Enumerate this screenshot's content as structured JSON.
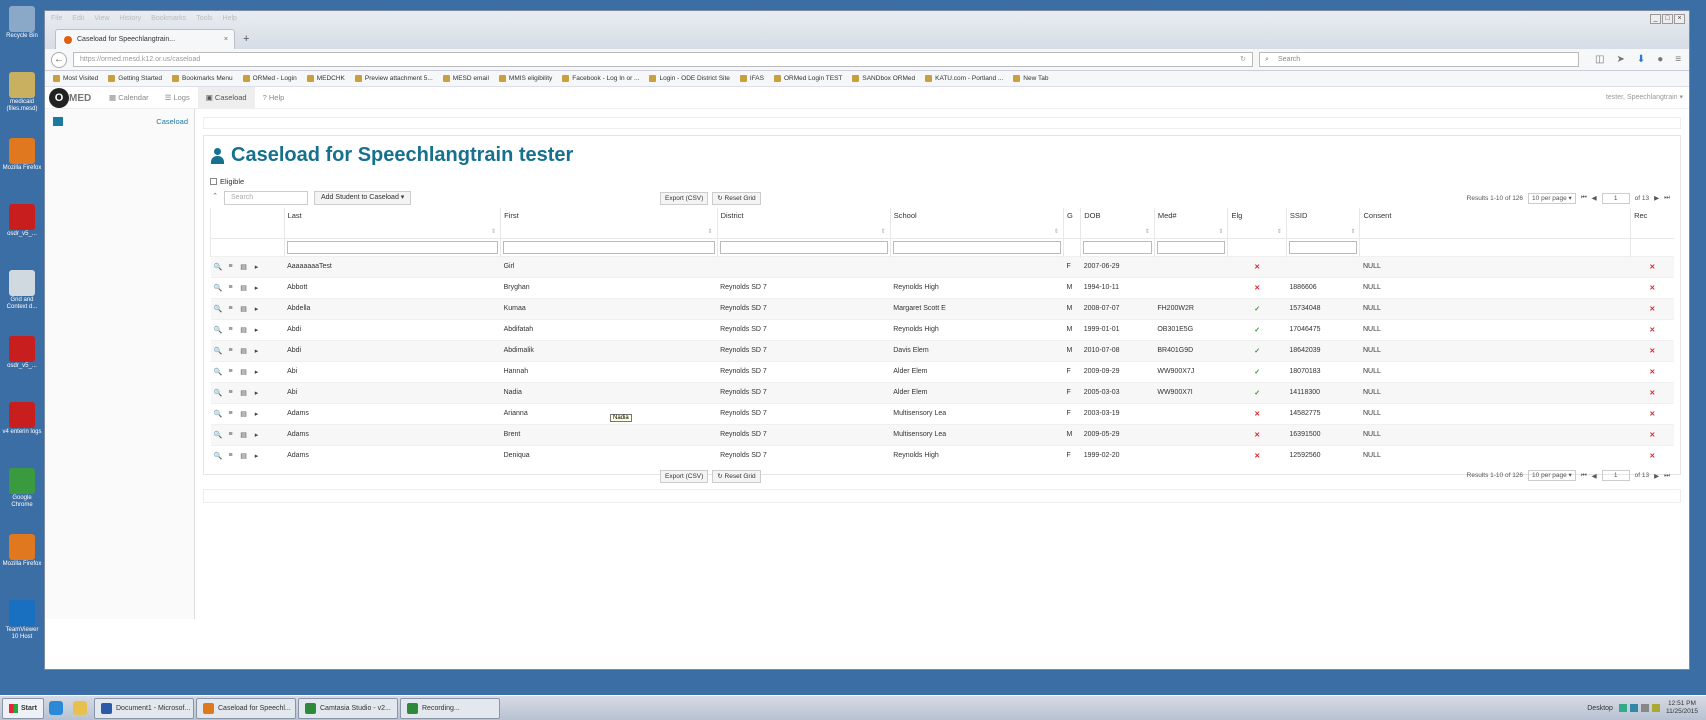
{
  "desktop": {
    "icons": [
      {
        "label": "Recycle Bin",
        "color": "#8aa8c8"
      },
      {
        "label": "medicaid (files.mesd)",
        "color": "#c8b060"
      },
      {
        "label": "Mozilla Firefox",
        "color": "#e07820"
      },
      {
        "label": "osdr_v5_...",
        "color": "#c81e1e"
      },
      {
        "label": "Grid and Context d...",
        "color": "#d0d8e0"
      },
      {
        "label": "osdr_v5_...",
        "color": "#c81e1e"
      },
      {
        "label": "v4 enterin logs",
        "color": "#c81e1e"
      },
      {
        "label": "Google Chrome",
        "color": "#3a9a40"
      },
      {
        "label": "Mozilla Firefox",
        "color": "#e07820"
      },
      {
        "label": "TeamViewer 10 Host",
        "color": "#1a70c0"
      }
    ]
  },
  "browser": {
    "menu": [
      "File",
      "Edit",
      "View",
      "History",
      "Bookmarks",
      "Tools",
      "Help"
    ],
    "tab_title": "Caseload for Speechlangtrain...",
    "tab_close": "×",
    "new_tab": "+",
    "url": "https://ormed.mesd.k12.or.us/caseload",
    "search_placeholder": "Search",
    "bookmarks": [
      "Most Visited",
      "Getting Started",
      "Bookmarks Menu",
      "ORMed - Login",
      "MEDCHK",
      "Preview attachment 5...",
      "MESD email",
      "MMIS eligibility",
      "Facebook - Log In or ...",
      "Login - ODE District Site",
      "IFAS",
      "ORMed Login TEST",
      "SANDbox ORMed",
      "KATU.com - Portland ...",
      "New Tab"
    ]
  },
  "app": {
    "logo_o": "O",
    "logo_rest": "MED",
    "nav": [
      {
        "label": "Calendar",
        "icon": "▦"
      },
      {
        "label": "Logs",
        "icon": "☰"
      },
      {
        "label": "Caseload",
        "icon": "▣"
      },
      {
        "label": "Help",
        "icon": "?"
      }
    ],
    "user": "tester, Speechlangtrain ▾",
    "sidebar_link": "Caseload",
    "title": "Caseload for Speechlangtrain tester",
    "eligible_label": "Eligible",
    "search_placeholder": "Search",
    "add_student": "Add Student to Caseload ▾",
    "export": "Export (CSV)",
    "reset": "↻ Reset Grid",
    "results": "Results 1-10 of 126",
    "per_page": "10 per page ▾",
    "page": "1",
    "of_pages": "of 13",
    "columns": [
      "Last",
      "First",
      "District",
      "School",
      "G",
      "DOB",
      "Med#",
      "Elg",
      "SSID",
      "Consent",
      "Rec"
    ],
    "rows": [
      {
        "last": "AaaaaaaaTest",
        "first": "Girl",
        "district": "",
        "school": "",
        "g": "F",
        "dob": "2007-06-29",
        "med": "",
        "elg": "x",
        "ssid": "",
        "consent": "NULL",
        "rec": "x"
      },
      {
        "last": "Abbott",
        "first": "Bryghan",
        "district": "Reynolds SD 7",
        "school": "Reynolds High",
        "g": "M",
        "dob": "1994-10-11",
        "med": "",
        "elg": "x",
        "ssid": "1886606",
        "consent": "NULL",
        "rec": "x"
      },
      {
        "last": "Abdella",
        "first": "Kumaa",
        "district": "Reynolds SD 7",
        "school": "Margaret Scott E",
        "g": "M",
        "dob": "2008-07-07",
        "med": "FH200W2R",
        "elg": "v",
        "ssid": "15734048",
        "consent": "NULL",
        "rec": "x"
      },
      {
        "last": "Abdi",
        "first": "Abdifatah",
        "district": "Reynolds SD 7",
        "school": "Reynolds High",
        "g": "M",
        "dob": "1999-01-01",
        "med": "OB301E5G",
        "elg": "v",
        "ssid": "17046475",
        "consent": "NULL",
        "rec": "x"
      },
      {
        "last": "Abdi",
        "first": "Abdimalik",
        "district": "Reynolds SD 7",
        "school": "Davis Elem",
        "g": "M",
        "dob": "2010-07-08",
        "med": "BR401G9D",
        "elg": "v",
        "ssid": "18642039",
        "consent": "NULL",
        "rec": "x"
      },
      {
        "last": "Abi",
        "first": "Hannah",
        "district": "Reynolds SD 7",
        "school": "Alder Elem",
        "g": "F",
        "dob": "2009-09-29",
        "med": "WW900X7J",
        "elg": "v",
        "ssid": "18070183",
        "consent": "NULL",
        "rec": "x"
      },
      {
        "last": "Abi",
        "first": "Nadia",
        "district": "Reynolds SD 7",
        "school": "Alder Elem",
        "g": "F",
        "dob": "2005-03-03",
        "med": "WW900X7I",
        "elg": "v",
        "ssid": "14118300",
        "consent": "NULL",
        "rec": "x"
      },
      {
        "last": "Adams",
        "first": "Arianna",
        "district": "Reynolds SD 7",
        "school": "Multisensory Lea",
        "g": "F",
        "dob": "2003-03-19",
        "med": "",
        "elg": "x",
        "ssid": "14582775",
        "consent": "NULL",
        "rec": "x"
      },
      {
        "last": "Adams",
        "first": "Brent",
        "district": "Reynolds SD 7",
        "school": "Multisensory Lea",
        "g": "M",
        "dob": "2009-05-29",
        "med": "",
        "elg": "x",
        "ssid": "16391500",
        "consent": "NULL",
        "rec": "x"
      },
      {
        "last": "Adams",
        "first": "Deniqua",
        "district": "Reynolds SD 7",
        "school": "Reynolds High",
        "g": "F",
        "dob": "1999-02-20",
        "med": "",
        "elg": "x",
        "ssid": "12592560",
        "consent": "NULL",
        "rec": "x"
      }
    ],
    "tooltip": "Nadia"
  },
  "taskbar": {
    "start": "Start",
    "tasks": [
      {
        "label": "Document1 - Microsof...",
        "color": "#2a5aa8"
      },
      {
        "label": "Caseload for Speechl...",
        "color": "#e07820"
      },
      {
        "label": "Camtasia Studio - v2...",
        "color": "#2c8a3a"
      },
      {
        "label": "Recording...",
        "color": "#2c8a3a"
      }
    ],
    "desktop_label": "Desktop",
    "time": "12:51 PM",
    "date": "11/25/2015"
  },
  "colors": {
    "accent": "#16708e",
    "error": "#d9232d",
    "ok": "#2c9a2c"
  }
}
